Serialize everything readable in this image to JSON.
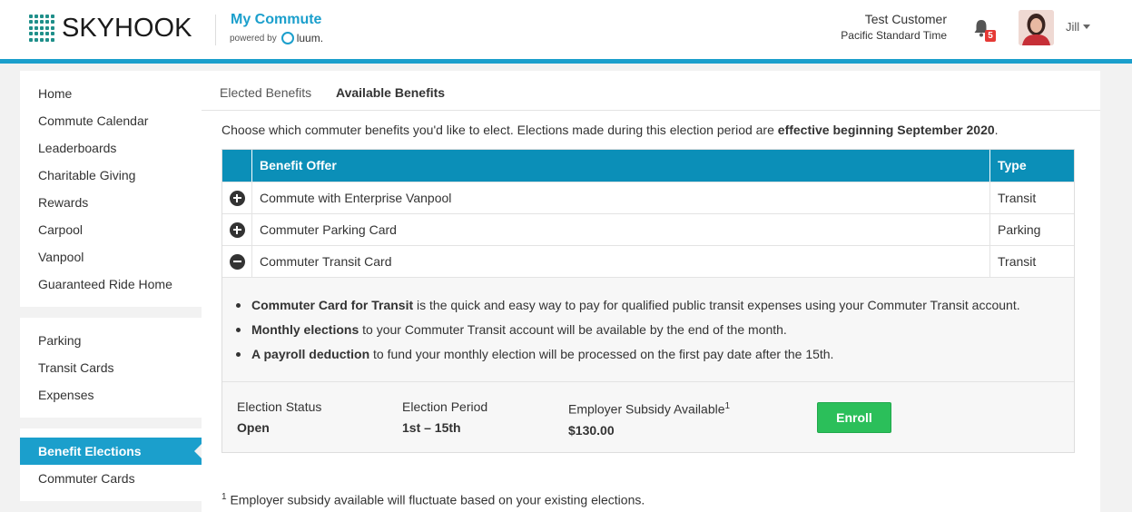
{
  "header": {
    "logo_text": "SKYHOOK",
    "app_title": "My Commute",
    "powered_by": "powered by",
    "powered_brand": "luum.",
    "user_name": "Test Customer",
    "time_zone": "Pacific Standard Time",
    "notification_count": "5",
    "user_menu_label": "Jill",
    "accent_color": "#1b9fcc"
  },
  "sidebar": {
    "groups": [
      [
        "Home",
        "Commute Calendar",
        "Leaderboards",
        "Charitable Giving",
        "Rewards",
        "Carpool",
        "Vanpool",
        "Guaranteed Ride Home"
      ],
      [
        "Parking",
        "Transit Cards",
        "Expenses"
      ],
      [
        "Benefit Elections",
        "Commuter Cards"
      ]
    ],
    "active_item": "Benefit Elections"
  },
  "tabs": {
    "elected": "Elected Benefits",
    "available": "Available Benefits"
  },
  "intro": {
    "text": "Choose which commuter benefits you'd like to elect. Elections made during this election period are ",
    "emphasis": "effective beginning September 2020",
    "end": "."
  },
  "table": {
    "headers": {
      "offer": "Benefit Offer",
      "type": "Type"
    },
    "rows": [
      {
        "icon": "plus-circle-icon",
        "offer": "Commute with Enterprise Vanpool",
        "type": "Transit"
      },
      {
        "icon": "plus-circle-icon",
        "offer": "Commuter Parking Card",
        "type": "Parking"
      },
      {
        "icon": "minus-circle-icon",
        "offer": "Commuter Transit Card",
        "type": "Transit"
      }
    ]
  },
  "details": [
    {
      "bold": "Commuter Card for Transit",
      "text": " is the quick and easy way to pay for qualified public transit expenses using your Commuter Transit account."
    },
    {
      "bold": "Monthly elections",
      "text": " to your Commuter Transit account will be available by the end of the month."
    },
    {
      "bold": "A payroll deduction",
      "text": " to fund your monthly election will be processed on the first pay date after the 15th."
    }
  ],
  "enrollment": {
    "status_label": "Election Status",
    "status_value": "Open",
    "period_label": "Election Period",
    "period_value": "1st – 15th",
    "subsidy_label": "Employer Subsidy Available",
    "subsidy_sup": "1",
    "subsidy_value": "$130.00",
    "enroll_button": "Enroll"
  },
  "footnote": {
    "sup": "1",
    "text": " Employer subsidy available will fluctuate based on your existing elections."
  }
}
